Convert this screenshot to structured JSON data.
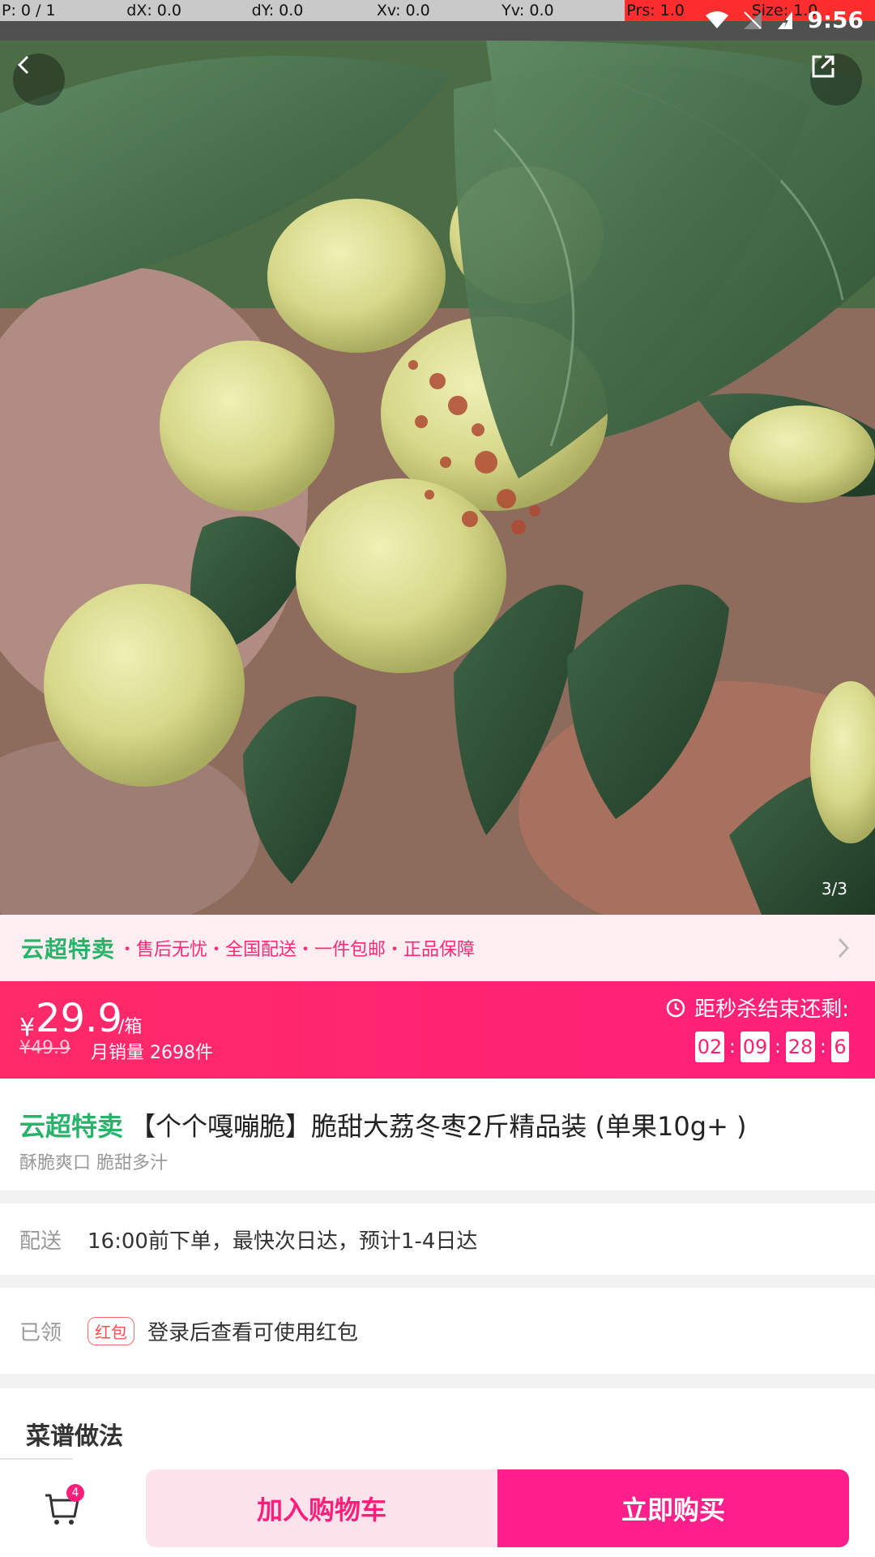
{
  "debug_bar": {
    "p": "P: 0 / 1",
    "dx": "dX: 0.0",
    "dy": "dY: 0.0",
    "xv": "Xv: 0.0",
    "yv": "Yv: 0.0",
    "prs": "Prs: 1.0",
    "size": "Size: 1.0"
  },
  "status_bar": {
    "time": "9:56"
  },
  "gallery": {
    "pager": "3/3"
  },
  "promo": {
    "brand": "云超特卖",
    "tags": "・售后无忧・全国配送・一件包邮・正品保障"
  },
  "price": {
    "currency": "¥",
    "value": "29.9",
    "unit": "/箱",
    "original": "¥49.9",
    "monthly_sales": "月销量 2698件",
    "countdown_title": "距秒杀结束还剩:",
    "countdown": {
      "h": "02",
      "m": "09",
      "s": "28",
      "ms": "6"
    }
  },
  "product": {
    "brand": "云超特卖",
    "title": "【个个嘎嘣脆】脆甜大荔冬枣2斤精品装 (单果10g+ )",
    "subtitle": "酥脆爽口 脆甜多汁"
  },
  "delivery": {
    "label": "配送",
    "text": "16:00前下单，最快次日达，预计1-4日达"
  },
  "coupon": {
    "label": "已领",
    "tag": "红包",
    "text": "登录后查看可使用红包"
  },
  "recipe": {
    "heading": "菜谱做法"
  },
  "bottom_bar": {
    "cart_count": "4",
    "add_to_cart": "加入购物车",
    "buy_now": "立即购买"
  },
  "colors": {
    "accent": "#ff1f7b",
    "brand_green": "#29b36a"
  }
}
